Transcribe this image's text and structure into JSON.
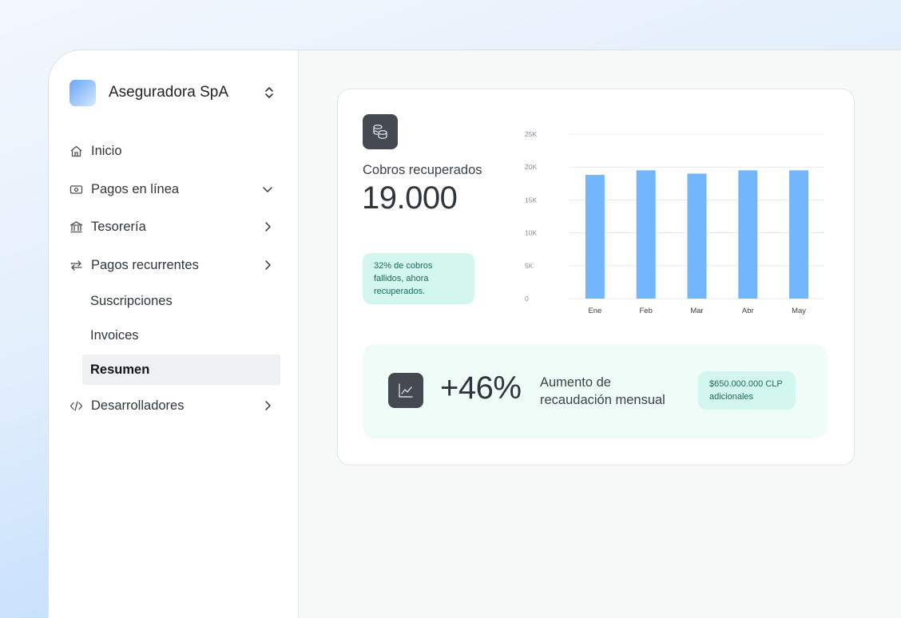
{
  "org": {
    "name": "Aseguradora SpA"
  },
  "nav": {
    "inicio": "Inicio",
    "pagos_linea": "Pagos en línea",
    "tesoreria": "Tesorería",
    "pagos_recurrentes": "Pagos recurrentes",
    "sub": [
      "Suscripciones",
      "Invoices",
      "Resumen"
    ],
    "desarrolladores": "Desarrolladores"
  },
  "metric": {
    "label": "Cobros recuperados",
    "value": "19.000",
    "note": "32% de cobros fallidos, ahora recuperados."
  },
  "chart_data": {
    "type": "bar",
    "categories": [
      "Ene",
      "Feb",
      "Mar",
      "Abr",
      "May"
    ],
    "values": [
      18800,
      19500,
      19000,
      19500,
      19500
    ],
    "ylim": [
      0,
      25000
    ],
    "yticks": [
      "0",
      "5K",
      "10K",
      "15K",
      "20K",
      "25K"
    ],
    "grid": true,
    "bar_color": "#74b6fb"
  },
  "growth": {
    "value": "+46%",
    "label": "Aumento de recaudación mensual",
    "note": "$650.000.000 CLP adicionales"
  },
  "icons": [
    "chevron-updown-icon",
    "home-icon",
    "banknote-icon",
    "chevron-down-icon",
    "bank-icon",
    "chevron-right-icon",
    "arrows-swap-icon",
    "code-icon",
    "coins-icon",
    "trend-chart-icon"
  ],
  "colors": {
    "accent": "#74b6fb",
    "pill_bg": "#d3f7ef",
    "pill_text": "#1b6b5c",
    "icon_tile": "#454a51"
  }
}
